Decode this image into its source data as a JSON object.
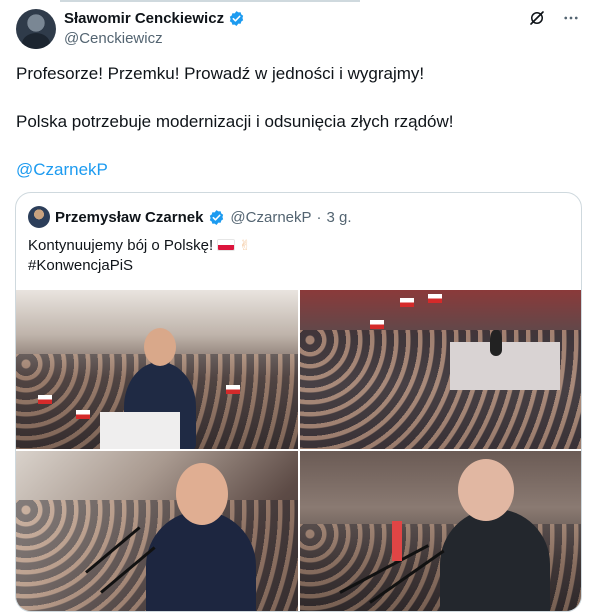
{
  "tweet": {
    "display_name": "Sławomir Cenckiewicz",
    "handle": "@Cenckiewicz",
    "text_line1": "Profesorze! Przemku! Prowadź w jedności i wygrajmy!",
    "text_line2": "Polska potrzebuje modernizacji i odsunięcia złych rządów!",
    "mention": "@CzarnekP"
  },
  "quoted_tweet": {
    "display_name": "Przemysław Czarnek",
    "handle": "@CzarnekP",
    "separator": "·",
    "time": "3 g.",
    "text_line1": "Kontynuujemy bój o Polskę!",
    "hashtag": "#KonwencjaPiS",
    "emoji": [
      "polish-flag",
      "victory-hand"
    ]
  },
  "icons": [
    "verified-badge-icon",
    "grok-icon",
    "more-icon"
  ],
  "colors": {
    "verified": "#1d9bf0",
    "link": "#1d9bf0",
    "secondary_text": "#536471",
    "border": "#cfd9de"
  },
  "photos": [
    "photo-speaker-podium",
    "photo-hall-crowd",
    "photo-speaker-closeup",
    "photo-elder-speaker"
  ]
}
